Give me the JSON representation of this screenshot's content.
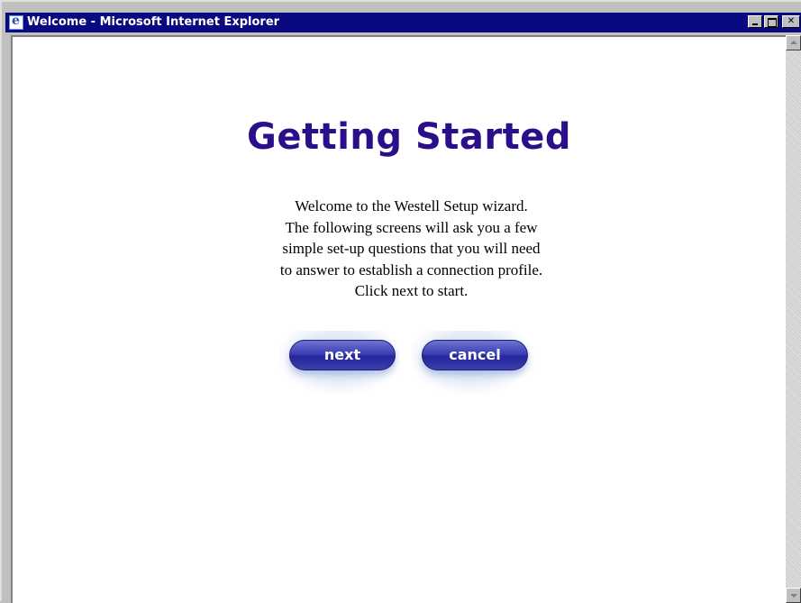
{
  "window": {
    "title": "Welcome - Microsoft Internet Explorer",
    "icon": "ie-icon"
  },
  "page": {
    "heading": "Getting Started",
    "intro_lines": [
      "Welcome to the Westell Setup wizard.",
      "The following screens will ask you a few",
      "simple set-up questions that you will need",
      "to answer to establish a connection profile.",
      "Click next to start."
    ]
  },
  "buttons": {
    "next_label": "next",
    "cancel_label": "cancel"
  },
  "colors": {
    "titlebar": "#0a0a80",
    "heading": "#2b0e8a",
    "button": "#3d3fb4"
  }
}
